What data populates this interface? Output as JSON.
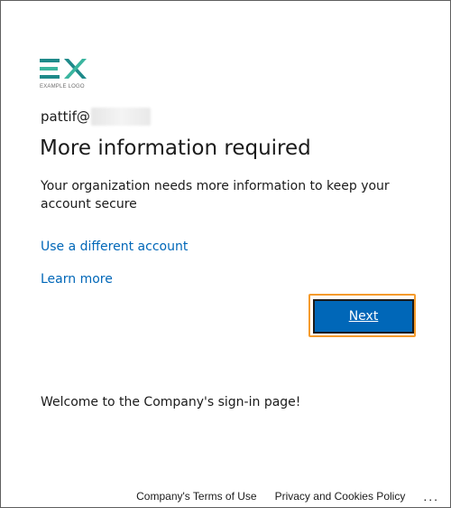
{
  "logo": {
    "caption": "EXAMPLE LOGO",
    "teal": "#1e8a8a",
    "green": "#3ab59f"
  },
  "identity": {
    "email_prefix": "pattif@"
  },
  "heading": {
    "title": "More information required"
  },
  "body": {
    "description": "Your organization needs more information to keep your account secure",
    "use_different_account": "Use a different account",
    "learn_more": "Learn more",
    "welcome": "Welcome to the Company's sign-in page!"
  },
  "actions": {
    "next_label": "Next",
    "accent": "#0067b8",
    "highlight": "#f59b2c"
  },
  "footer": {
    "terms": "Company's Terms of Use",
    "privacy": "Privacy and Cookies Policy",
    "more": "..."
  }
}
